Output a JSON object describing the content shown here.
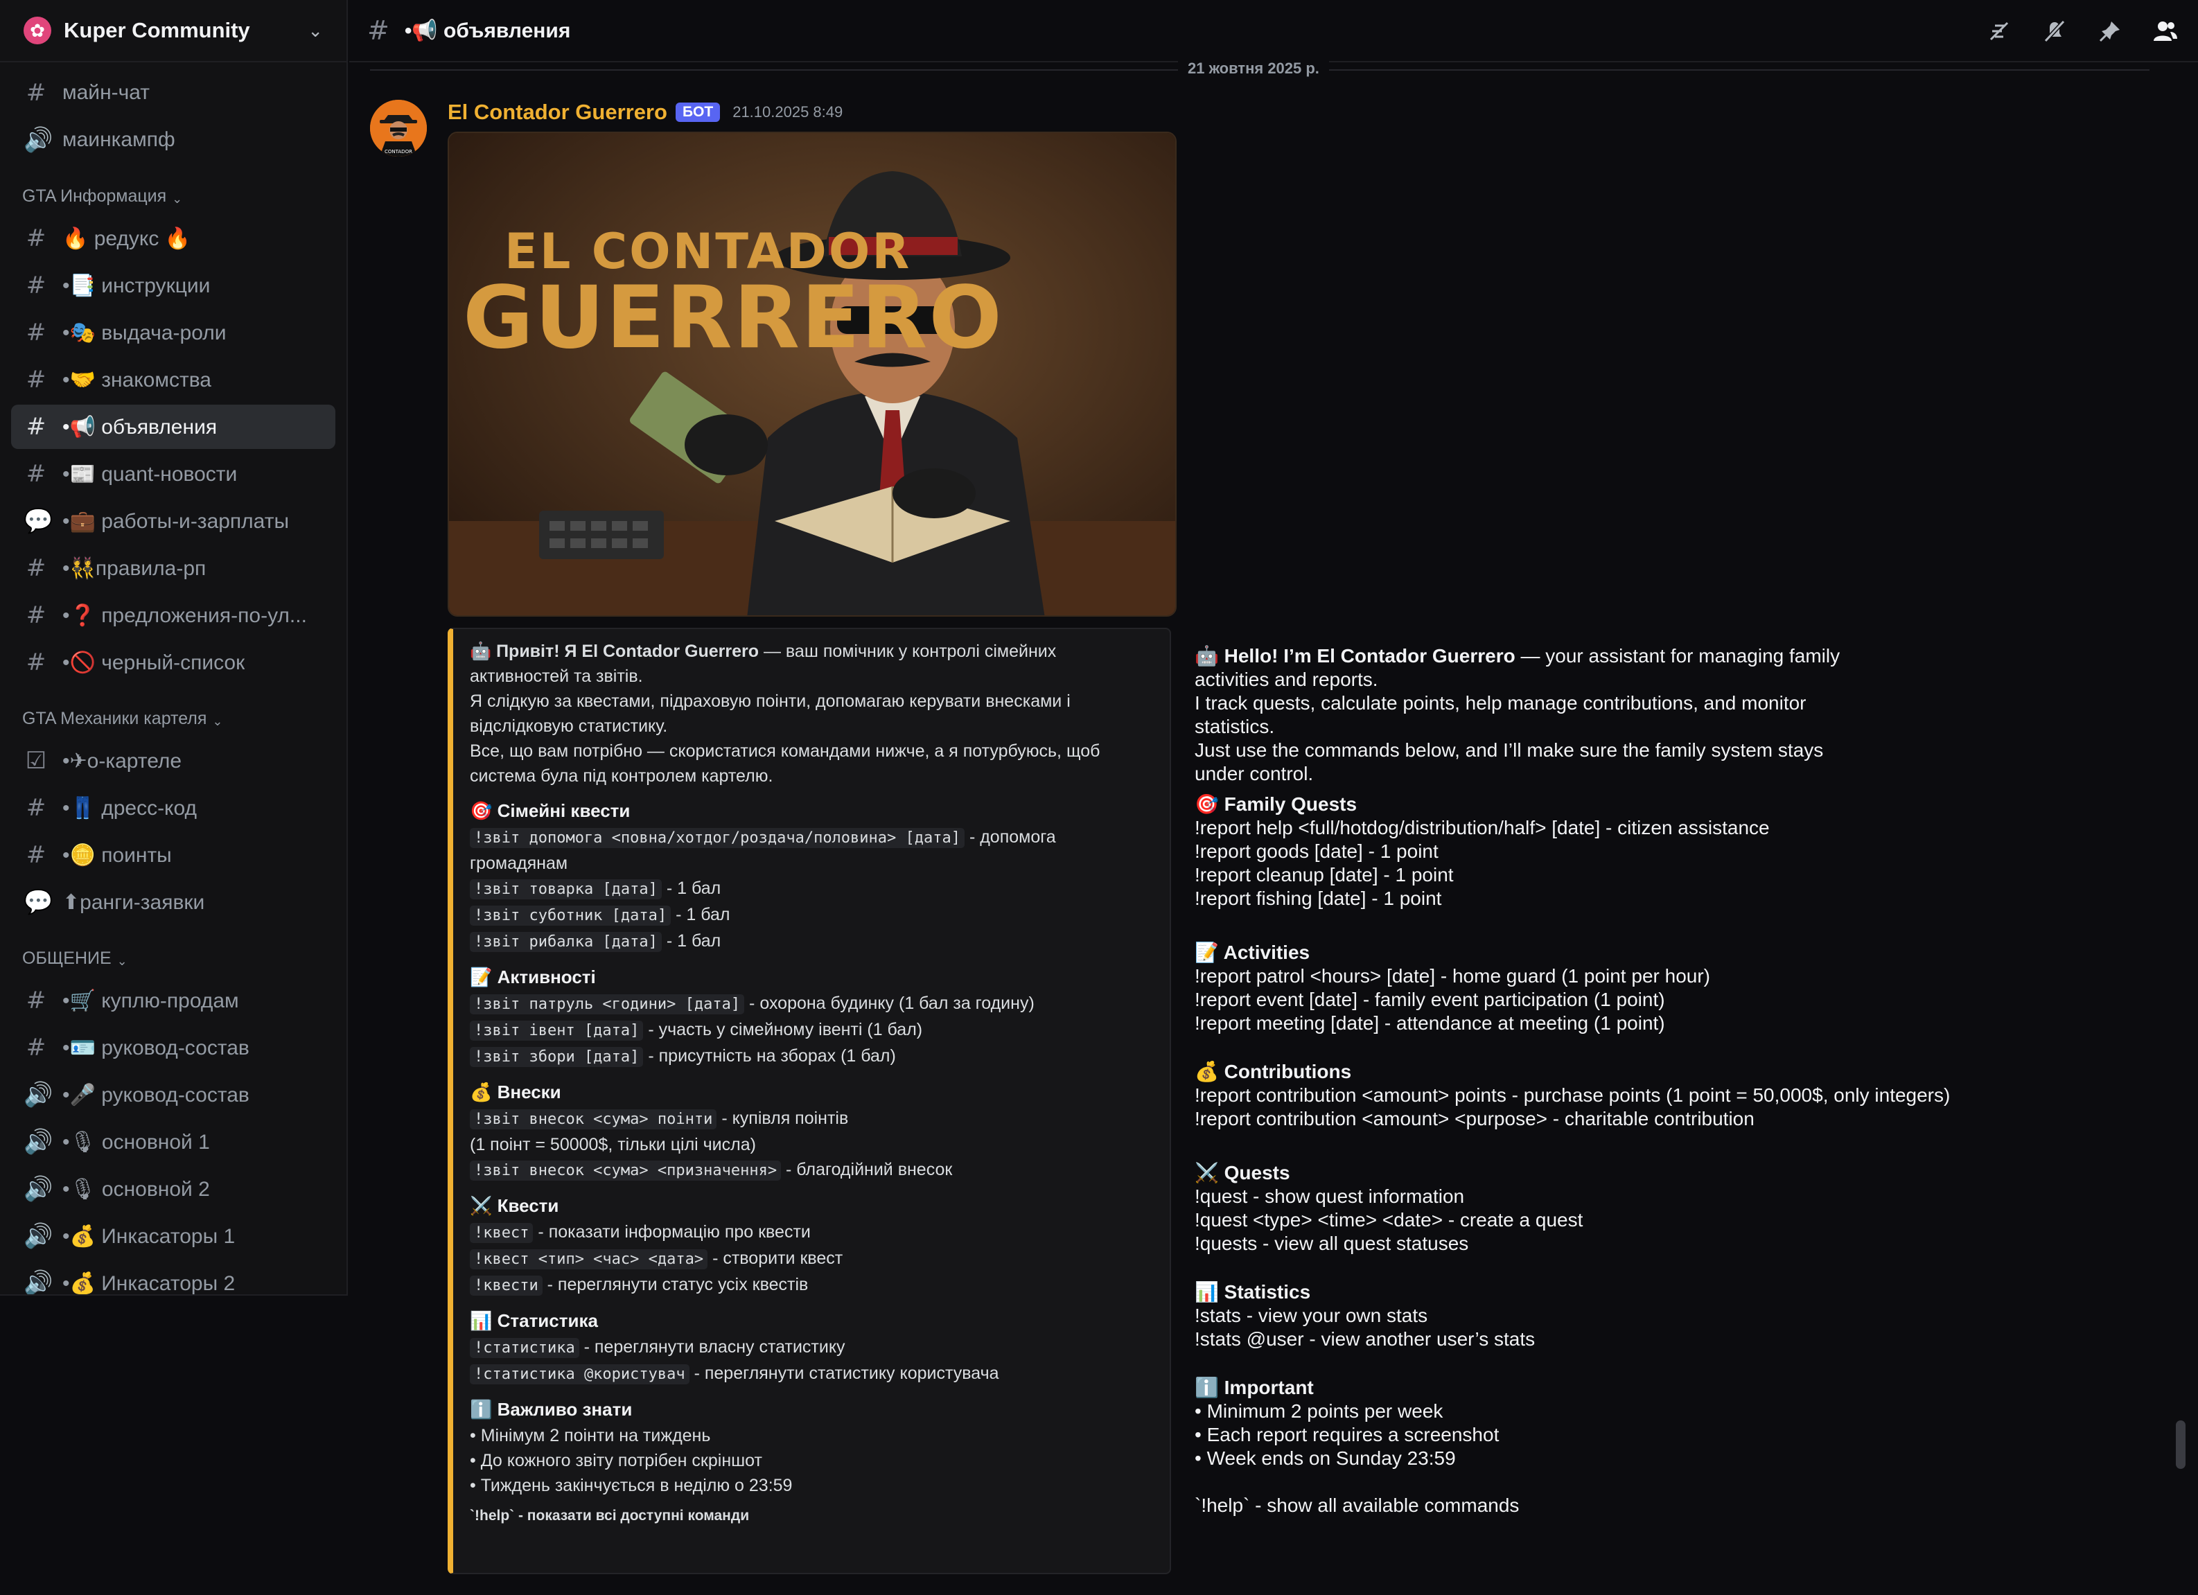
{
  "server": {
    "name": "Kuper Community",
    "icon": "flower-icon"
  },
  "channel": {
    "title": "•📢 объявления"
  },
  "sidebar": {
    "channels_top": [
      {
        "icon": "#",
        "label": "майн-чат"
      },
      {
        "icon": "🔊",
        "label": "маинкампф"
      }
    ],
    "categories": [
      {
        "name": "GTA Информация",
        "channels": [
          {
            "icon": "#",
            "label": "🔥 редукс 🔥"
          },
          {
            "icon": "#",
            "label": "•📑 инструкции"
          },
          {
            "icon": "#",
            "label": "•🎭 выдача-роли"
          },
          {
            "icon": "#",
            "label": "•🤝 знакомства"
          },
          {
            "icon": "#",
            "label": "•📢 объявления",
            "active": true
          },
          {
            "icon": "#",
            "label": "•📰 quant-новости"
          },
          {
            "icon": "💬",
            "label": "•💼 работы-и-зарплаты"
          },
          {
            "icon": "#",
            "label": "•👯правила-рп"
          },
          {
            "icon": "#",
            "label": "•❓ предложения-по-ул..."
          },
          {
            "icon": "#",
            "label": "•🚫 черный-список"
          }
        ]
      },
      {
        "name": "GTA Механики картеля",
        "channels": [
          {
            "icon": "☑",
            "label": "•✈о-картеле"
          },
          {
            "icon": "#",
            "label": "•👖 дресс-код"
          },
          {
            "icon": "#",
            "label": "•🪙 поинты"
          },
          {
            "icon": "💬",
            "label": "⬆ранги-заявки"
          }
        ]
      },
      {
        "name": "ОБЩЕНИЕ",
        "channels": [
          {
            "icon": "#",
            "label": "•🛒 куплю-продам"
          },
          {
            "icon": "#",
            "label": "•🪪 руковод-состав"
          },
          {
            "icon": "🔊",
            "label": "•🎤 руковод-состав"
          },
          {
            "icon": "🔊",
            "label": "•🎙 основной 1"
          },
          {
            "icon": "🔊",
            "label": "•🎙 основной 2"
          },
          {
            "icon": "🔊",
            "label": "•💰 Инкасаторы 1"
          },
          {
            "icon": "🔊",
            "label": "•💰 Инкасаторы 2"
          }
        ]
      }
    ]
  },
  "top_icons": [
    "threads-icon",
    "mute-bell-icon",
    "pin-icon",
    "members-icon"
  ],
  "date_divider": "21 жовтня 2025 р.",
  "message": {
    "author": "El Contador Guerrero",
    "badge": "БОТ",
    "timestamp": "21.10.2025 8:49",
    "image_text_line1": "EL CONTADOR",
    "image_text_line2": "GUERRERO",
    "embed": {
      "intro_1a": "🤖 Привіт! Я El Contador Guerrero",
      "intro_1b": " — ваш помічник у контролі сімейних",
      "intro_2": "активностей та звітів.",
      "intro_3": "Я слідкую за квестами, підраховую поінти, допомагаю керувати внесками і",
      "intro_4": "відслідковую статистику.",
      "intro_5": "Все, що вам потрібно — скористатися командами нижче, а я потурбуюсь, щоб",
      "intro_6": "система була під контролем картелю.",
      "sec_family": "🎯 Сімейні квести",
      "f1_code": "!звіт допомога <повна/хотдог/роздача/половина> [дата]",
      "f1_text": " - допомога",
      "f1_text2": "громадянам",
      "f2_code": "!звіт товарка [дата]",
      "f2_text": " - 1 бал",
      "f3_code": "!звіт суботник [дата]",
      "f3_text": " - 1 бал",
      "f4_code": "!звіт рибалка [дата]",
      "f4_text": " - 1 бал",
      "sec_activities": "📝 Активності",
      "a1_code": "!звіт патруль <години> [дата]",
      "a1_text": " - охорона будинку (1 бал за годину)",
      "a2_code": "!звіт івент [дата]",
      "a2_text": " - участь у сімейному івенті (1 бал)",
      "a3_code": "!звіт збори [дата]",
      "a3_text": " - присутність на зборах (1 бал)",
      "sec_contrib": "💰 Внески",
      "c1_code": "!звіт внесок <сума> поінти",
      "c1_text": " - купівля поінтів",
      "c1_text2": "(1 поінт = 50000$, тільки цілі числа)",
      "c2_code": "!звіт внесок <сума> <призначення>",
      "c2_text": " - благодійний внесок",
      "sec_quests": "⚔️ Квести",
      "q1_code": "!квест",
      "q1_text": " - показати інформацію про квести",
      "q2_code": "!квест <тип> <час> <дата>",
      "q2_text": " - створити квест",
      "q3_code": "!квести",
      "q3_text": " - переглянути статус усіх квестів",
      "sec_stats": "📊 Статистика",
      "s1_code": "!статистика",
      "s1_text": " - переглянути власну статистику",
      "s2_code": "!статистика @користувач",
      "s2_text": " - переглянути статистику користувача",
      "sec_important": "ℹ️ Важливо знати",
      "i1": "• Мінімум 2 поінти на тиждень",
      "i2": "• До кожного звіту потрібен скріншот",
      "i3": "• Тиждень закінчується в неділю о 23:59",
      "footer": "`!help` - показати всі доступні команди"
    },
    "translation": {
      "intro_1a": "🤖 Hello! I’m El Contador Guerrero",
      "intro_1b": " — your assistant for managing family",
      "intro_2": "activities and reports.",
      "intro_3": "I track quests, calculate points, help manage contributions, and monitor",
      "intro_4": "statistics.",
      "intro_5": "Just use the commands below, and I’ll make sure the family system stays",
      "intro_6": "under control.",
      "sec_family": "🎯 Family Quests",
      "f1": "!report help <full/hotdog/distribution/half> [date] - citizen assistance",
      "f2": "!report goods [date] - 1 point",
      "f3": "!report cleanup [date] - 1 point",
      "f4": "!report fishing [date] - 1 point",
      "sec_activities": "📝 Activities",
      "a1": "!report patrol <hours> [date] - home guard (1 point per hour)",
      "a2": "!report event [date] - family event participation (1 point)",
      "a3": "!report meeting [date] - attendance at meeting (1 point)",
      "sec_contrib": "💰 Contributions",
      "c1": "!report contribution <amount> points - purchase points (1 point = 50,000$, only integers)",
      "c2": "!report contribution <amount> <purpose> - charitable contribution",
      "sec_quests": "⚔️ Quests",
      "q1": "!quest - show quest information",
      "q2": "!quest <type> <time> <date> - create a quest",
      "q3": "!quests - view all quest statuses",
      "sec_stats": "📊 Statistics",
      "s1": "!stats - view your own stats",
      "s2": "!stats @user - view another user’s stats",
      "sec_important": "ℹ️ Important",
      "i1": "• Minimum 2 points per week",
      "i2": "• Each report requires a screenshot",
      "i3": "• Week ends on Sunday 23:59",
      "footer": "`!help` - show all available commands"
    }
  },
  "colors": {
    "accent_gold": "#f0b132",
    "bot_badge": "#5865f2",
    "background": "#0c0c0f",
    "sidebar": "#121214"
  }
}
